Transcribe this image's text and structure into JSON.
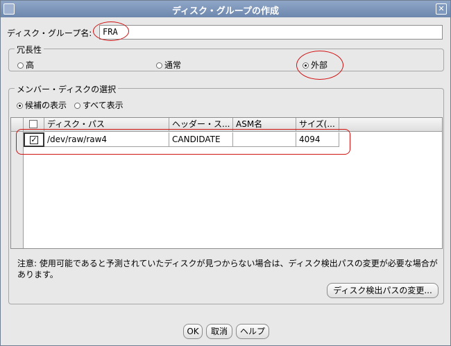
{
  "window": {
    "title": "ディスク・グループの作成"
  },
  "disk_group_name": {
    "label": "ディスク・グループ名:",
    "value": "FRA"
  },
  "redundancy": {
    "legend": "冗長性",
    "options": [
      {
        "label": "高",
        "selected": false
      },
      {
        "label": "通常",
        "selected": false
      },
      {
        "label": "外部",
        "selected": true
      }
    ]
  },
  "member_disks": {
    "legend": "メンバー・ディスクの選択",
    "filter_options": [
      {
        "label": "候補の表示",
        "selected": true
      },
      {
        "label": "すべて表示",
        "selected": false
      }
    ],
    "columns": [
      "ディスク・パス",
      "ヘッダー・ス...",
      "ASM名",
      "サイズ(..."
    ],
    "rows": [
      {
        "checked": true,
        "path": "/dev/raw/raw4",
        "header_status": "CANDIDATE",
        "asm_name": "",
        "size": "4094"
      }
    ]
  },
  "note": {
    "text": "注意: 使用可能であると予測されていたディスクが見つからない場合は、ディスク検出パスの変更が必要な場合があります。"
  },
  "change_discovery_path_button": "ディスク検出パスの変更...",
  "footer": {
    "ok": "OK",
    "cancel": "取消",
    "help": "ヘルプ"
  },
  "annotation_color": "#d11010"
}
